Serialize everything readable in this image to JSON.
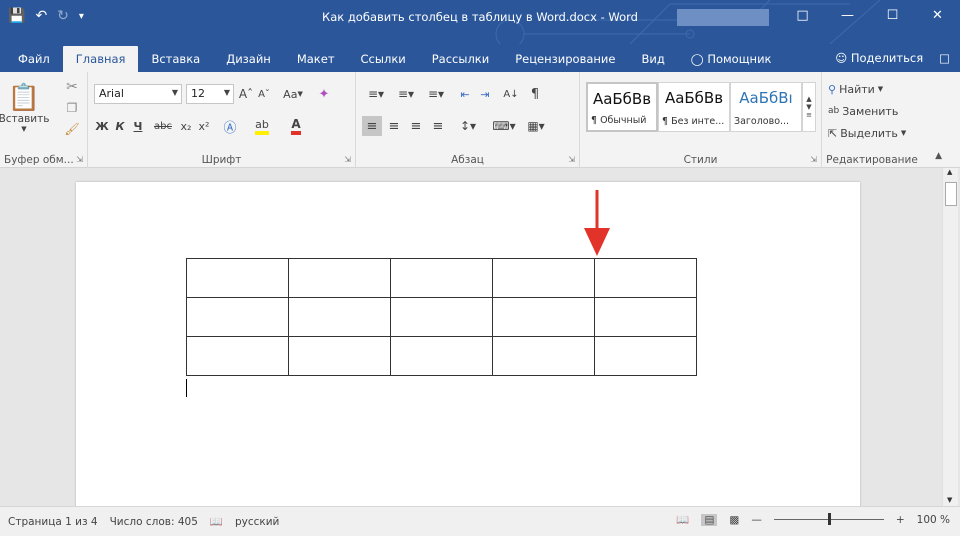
{
  "window": {
    "title": "Как добавить столбец в таблицу в Word.docx  -  Word"
  },
  "tabs": [
    {
      "label": "Файл"
    },
    {
      "label": "Главная"
    },
    {
      "label": "Вставка"
    },
    {
      "label": "Дизайн"
    },
    {
      "label": "Макет"
    },
    {
      "label": "Ссылки"
    },
    {
      "label": "Рассылки"
    },
    {
      "label": "Рецензирование"
    },
    {
      "label": "Вид"
    }
  ],
  "tell_me": "Помощник",
  "share": "Поделиться",
  "clipboard": {
    "paste_label": "Вставить",
    "group_label": "Буфер обм..."
  },
  "font": {
    "name": "Arial",
    "size": "12",
    "bold": "Ж",
    "italic": "К",
    "underline": "Ч",
    "strike": "abc",
    "change_case": "Aa",
    "group_label": "Шрифт"
  },
  "paragraph": {
    "group_label": "Абзац"
  },
  "styles": {
    "items": [
      {
        "sample": "АаБбВв",
        "name": "¶ Обычный"
      },
      {
        "sample": "АаБбВв",
        "name": "¶ Без инте..."
      },
      {
        "sample": "АаБбВı",
        "name": "Заголово..."
      }
    ],
    "group_label": "Стили"
  },
  "editing": {
    "find": "Найти",
    "replace": "Заменить",
    "select": "Выделить",
    "group_label": "Редактирование"
  },
  "status": {
    "page": "Страница 1 из 4",
    "words": "Число слов: 405",
    "language": "русский",
    "zoom": "100 %"
  },
  "table": {
    "rows": 3,
    "cols": 5
  },
  "colors": {
    "accent": "#2b579a",
    "arrow": "#e2332b"
  }
}
